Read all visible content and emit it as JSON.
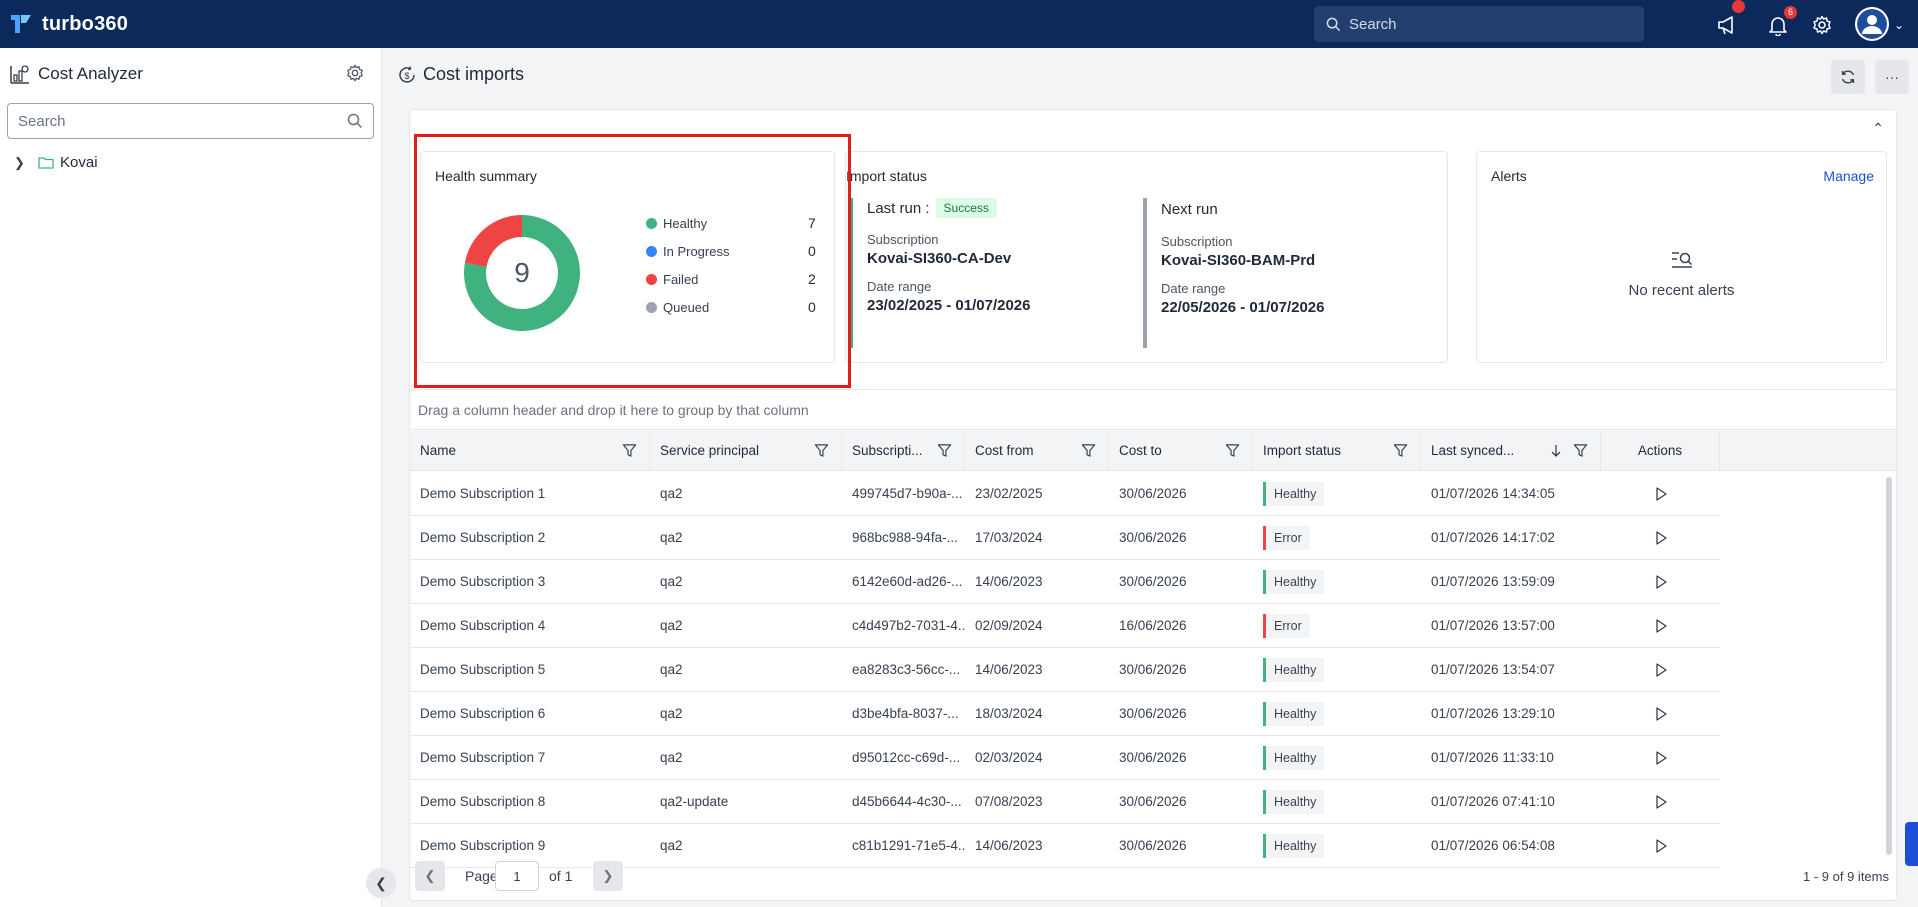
{
  "app": {
    "name": "turbo360"
  },
  "topbar": {
    "search_placeholder": "Search",
    "notification_count": "6",
    "icons": [
      "megaphone-icon",
      "bell-icon",
      "gear-icon",
      "user-avatar-icon"
    ]
  },
  "sidebar": {
    "title": "Cost Analyzer",
    "search_placeholder": "Search",
    "tree": [
      {
        "label": "Kovai",
        "expanded": false
      }
    ]
  },
  "page": {
    "title": "Cost imports"
  },
  "health_summary": {
    "title": "Health summary",
    "total": "9",
    "items": [
      {
        "label": "Healthy",
        "value": "7",
        "color": "#3fb27f"
      },
      {
        "label": "In Progress",
        "value": "0",
        "color": "#3b82f6"
      },
      {
        "label": "Failed",
        "value": "2",
        "color": "#ef4444"
      },
      {
        "label": "Queued",
        "value": "0",
        "color": "#9ca3af"
      }
    ]
  },
  "import_status": {
    "title": "Import status",
    "last_run": {
      "label": "Last run :",
      "status": "Success",
      "subscription_label": "Subscription",
      "subscription": "Kovai-SI360-CA-Dev",
      "date_range_label": "Date range",
      "date_range": "23/02/2025 - 01/07/2026"
    },
    "next_run": {
      "label": "Next run",
      "subscription_label": "Subscription",
      "subscription": "Kovai-SI360-BAM-Prd",
      "date_range_label": "Date range",
      "date_range": "22/05/2026 - 01/07/2026"
    }
  },
  "alerts": {
    "title": "Alerts",
    "manage_label": "Manage",
    "empty_text": "No recent alerts"
  },
  "grid": {
    "group_hint": "Drag a column header and drop it here to group by that column",
    "columns": [
      "Name",
      "Service principal",
      "Subscripti...",
      "Cost from",
      "Cost to",
      "Import status",
      "Last synced...",
      "Actions"
    ],
    "rows": [
      {
        "name": "Demo Subscription 1",
        "principal": "qa2",
        "subscription": "499745d7-b90a-...",
        "cost_from": "23/02/2025",
        "cost_to": "30/06/2026",
        "status": "Healthy",
        "last_synced": "01/07/2026 14:34:05"
      },
      {
        "name": "Demo Subscription 2",
        "principal": "qa2",
        "subscription": "968bc988-94fa-...",
        "cost_from": "17/03/2024",
        "cost_to": "30/06/2026",
        "status": "Error",
        "last_synced": "01/07/2026 14:17:02"
      },
      {
        "name": "Demo Subscription 3",
        "principal": "qa2",
        "subscription": "6142e60d-ad26-...",
        "cost_from": "14/06/2023",
        "cost_to": "30/06/2026",
        "status": "Healthy",
        "last_synced": "01/07/2026 13:59:09"
      },
      {
        "name": "Demo Subscription 4",
        "principal": "qa2",
        "subscription": "c4d497b2-7031-4...",
        "cost_from": "02/09/2024",
        "cost_to": "16/06/2026",
        "status": "Error",
        "last_synced": "01/07/2026 13:57:00"
      },
      {
        "name": "Demo Subscription 5",
        "principal": "qa2",
        "subscription": "ea8283c3-56cc-...",
        "cost_from": "14/06/2023",
        "cost_to": "30/06/2026",
        "status": "Healthy",
        "last_synced": "01/07/2026 13:54:07"
      },
      {
        "name": "Demo Subscription 6",
        "principal": "qa2",
        "subscription": "d3be4bfa-8037-...",
        "cost_from": "18/03/2024",
        "cost_to": "30/06/2026",
        "status": "Healthy",
        "last_synced": "01/07/2026 13:29:10"
      },
      {
        "name": "Demo Subscription 7",
        "principal": "qa2",
        "subscription": "d95012cc-c69d-...",
        "cost_from": "02/03/2024",
        "cost_to": "30/06/2026",
        "status": "Healthy",
        "last_synced": "01/07/2026 11:33:10"
      },
      {
        "name": "Demo Subscription 8",
        "principal": "qa2-update",
        "subscription": "d45b6644-4c30-...",
        "cost_from": "07/08/2023",
        "cost_to": "30/06/2026",
        "status": "Healthy",
        "last_synced": "01/07/2026 07:41:10"
      },
      {
        "name": "Demo Subscription 9",
        "principal": "qa2",
        "subscription": "c81b1291-71e5-4...",
        "cost_from": "14/06/2023",
        "cost_to": "30/06/2026",
        "status": "Healthy",
        "last_synced": "01/07/2026 06:54:08"
      }
    ]
  },
  "pager": {
    "page_label": "Page",
    "page_value": "1",
    "of_label": "of 1",
    "items_text": "1 - 9 of 9 items"
  },
  "colors": {
    "brand_dark": "#0b2a5b",
    "healthy": "#3fb27f",
    "error": "#ef4444",
    "highlight": "#e11d1d"
  }
}
